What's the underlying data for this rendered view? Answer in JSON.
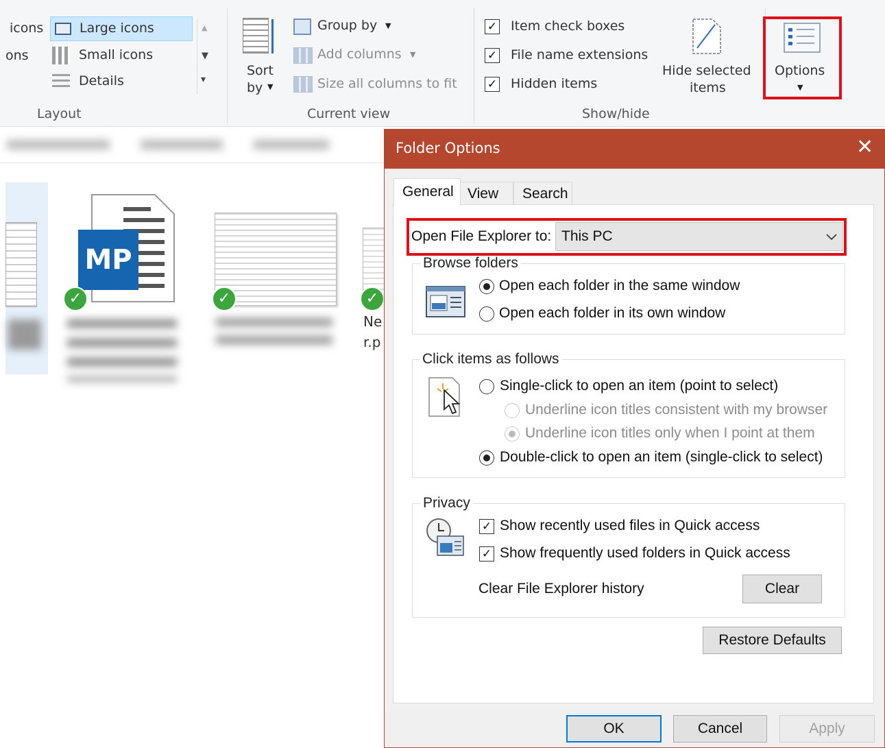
{
  "ribbon": {
    "layout": {
      "group": "Layout",
      "items": [
        "icons",
        "Large icons",
        "ons",
        "Small icons",
        "Details"
      ]
    },
    "current_view": {
      "group": "Current view",
      "sort_label": "Sort",
      "sort_by": "by",
      "group_by": "Group by",
      "add_columns": "Add columns",
      "size_columns": "Size all columns to fit"
    },
    "show_hide": {
      "group": "Show/hide",
      "item_check_boxes": "Item check boxes",
      "file_name_extensions": "File name extensions",
      "hidden_items": "Hidden items",
      "hide_selected_line1": "Hide selected",
      "hide_selected_line2": "items",
      "options": "Options"
    }
  },
  "files": {
    "partial_name_1": "Ne",
    "partial_name_2": "r.p",
    "thumb_badge": "MP"
  },
  "dialog": {
    "title": "Folder Options",
    "tabs": [
      "General",
      "View",
      "Search"
    ],
    "open_label": "Open File Explorer to:",
    "open_value": "This PC",
    "browse": {
      "legend": "Browse folders",
      "opt1": "Open each folder in the same window",
      "opt2": "Open each folder in its own window"
    },
    "click": {
      "legend": "Click items as follows",
      "opt1": "Single-click to open an item (point to select)",
      "sub1": "Underline icon titles consistent with my browser",
      "sub2": "Underline icon titles only when I point at them",
      "opt2": "Double-click to open an item (single-click to select)"
    },
    "privacy": {
      "legend": "Privacy",
      "chk1": "Show recently used files in Quick access",
      "chk2": "Show frequently used folders in Quick access",
      "clear_label": "Clear File Explorer history",
      "clear_button": "Clear"
    },
    "restore_defaults": "Restore Defaults",
    "ok": "OK",
    "cancel": "Cancel",
    "apply": "Apply"
  },
  "colors": {
    "title_bar": "#b5472e",
    "highlight": "#e0101a",
    "accent": "#0078d7"
  }
}
